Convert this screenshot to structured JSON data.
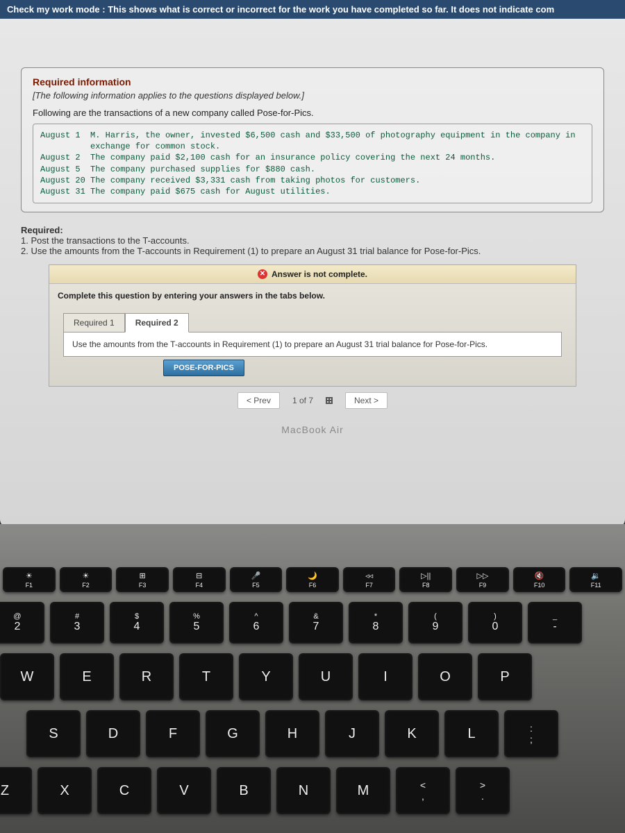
{
  "topbar": {
    "text": "Check my work mode : This shows what is correct or incorrect for the work you have completed so far. It does not indicate com"
  },
  "info": {
    "heading": "Required information",
    "note": "[The following information applies to the questions displayed below.]",
    "intro": "Following are the transactions of a new company called Pose-for-Pics.",
    "transactions": [
      "August 1  M. Harris, the owner, invested $6,500 cash and $33,500 of photography equipment in the company in",
      "          exchange for common stock.",
      "August 2  The company paid $2,100 cash for an insurance policy covering the next 24 months.",
      "August 5  The company purchased supplies for $880 cash.",
      "August 20 The company received $3,331 cash from taking photos for customers.",
      "August 31 The company paid $675 cash for August utilities."
    ]
  },
  "required": {
    "heading": "Required:",
    "items": [
      "1. Post the transactions to the T-accounts.",
      "2. Use the amounts from the T-accounts in Requirement (1) to prepare an August 31 trial balance for Pose-for-Pics."
    ]
  },
  "panel": {
    "status": "Answer is not complete.",
    "instruction": "Complete this question by entering your answers in the tabs below.",
    "tabs": [
      "Required 1",
      "Required 2"
    ],
    "tab_desc": "Use the amounts from the T-accounts in Requirement (1) to prepare an August 31 trial balance for Pose-for-Pics.",
    "pf_label": "POSE-FOR-PICS",
    "prev": "Prev",
    "counter": "1 of 7",
    "next": "Next"
  },
  "mba": "MacBook Air",
  "fn_keys": [
    {
      "icon": "☀",
      "label": "F1"
    },
    {
      "icon": "☀",
      "label": "F2"
    },
    {
      "icon": "⊞",
      "label": "F3"
    },
    {
      "icon": "⊟",
      "label": "F4"
    },
    {
      "icon": "🎤",
      "label": "F5"
    },
    {
      "icon": "🌙",
      "label": "F6"
    },
    {
      "icon": "◃◃",
      "label": "F7"
    },
    {
      "icon": "▷||",
      "label": "F8"
    },
    {
      "icon": "▷▷",
      "label": "F9"
    },
    {
      "icon": "🔇",
      "label": "F10"
    },
    {
      "icon": "🔉",
      "label": "F11"
    }
  ],
  "num_keys": [
    {
      "top": "@",
      "bot": "2"
    },
    {
      "top": "#",
      "bot": "3"
    },
    {
      "top": "$",
      "bot": "4"
    },
    {
      "top": "%",
      "bot": "5"
    },
    {
      "top": "^",
      "bot": "6"
    },
    {
      "top": "&",
      "bot": "7"
    },
    {
      "top": "*",
      "bot": "8"
    },
    {
      "top": "(",
      "bot": "9"
    },
    {
      "top": ")",
      "bot": "0"
    },
    {
      "top": "_",
      "bot": "-"
    }
  ],
  "row3_keys": [
    "W",
    "E",
    "R",
    "T",
    "Y",
    "U",
    "I",
    "O",
    "P"
  ],
  "row4_keys": [
    "S",
    "D",
    "F",
    "G",
    "H",
    "J",
    "K",
    "L"
  ],
  "row4_extra": {
    "top": ":",
    "bot": ";"
  },
  "row5_keys": [
    "Z",
    "X",
    "C",
    "V",
    "B",
    "N",
    "M"
  ],
  "row5_extra": [
    {
      "top": "<",
      "bot": ","
    },
    {
      "top": ">",
      "bot": "."
    }
  ]
}
